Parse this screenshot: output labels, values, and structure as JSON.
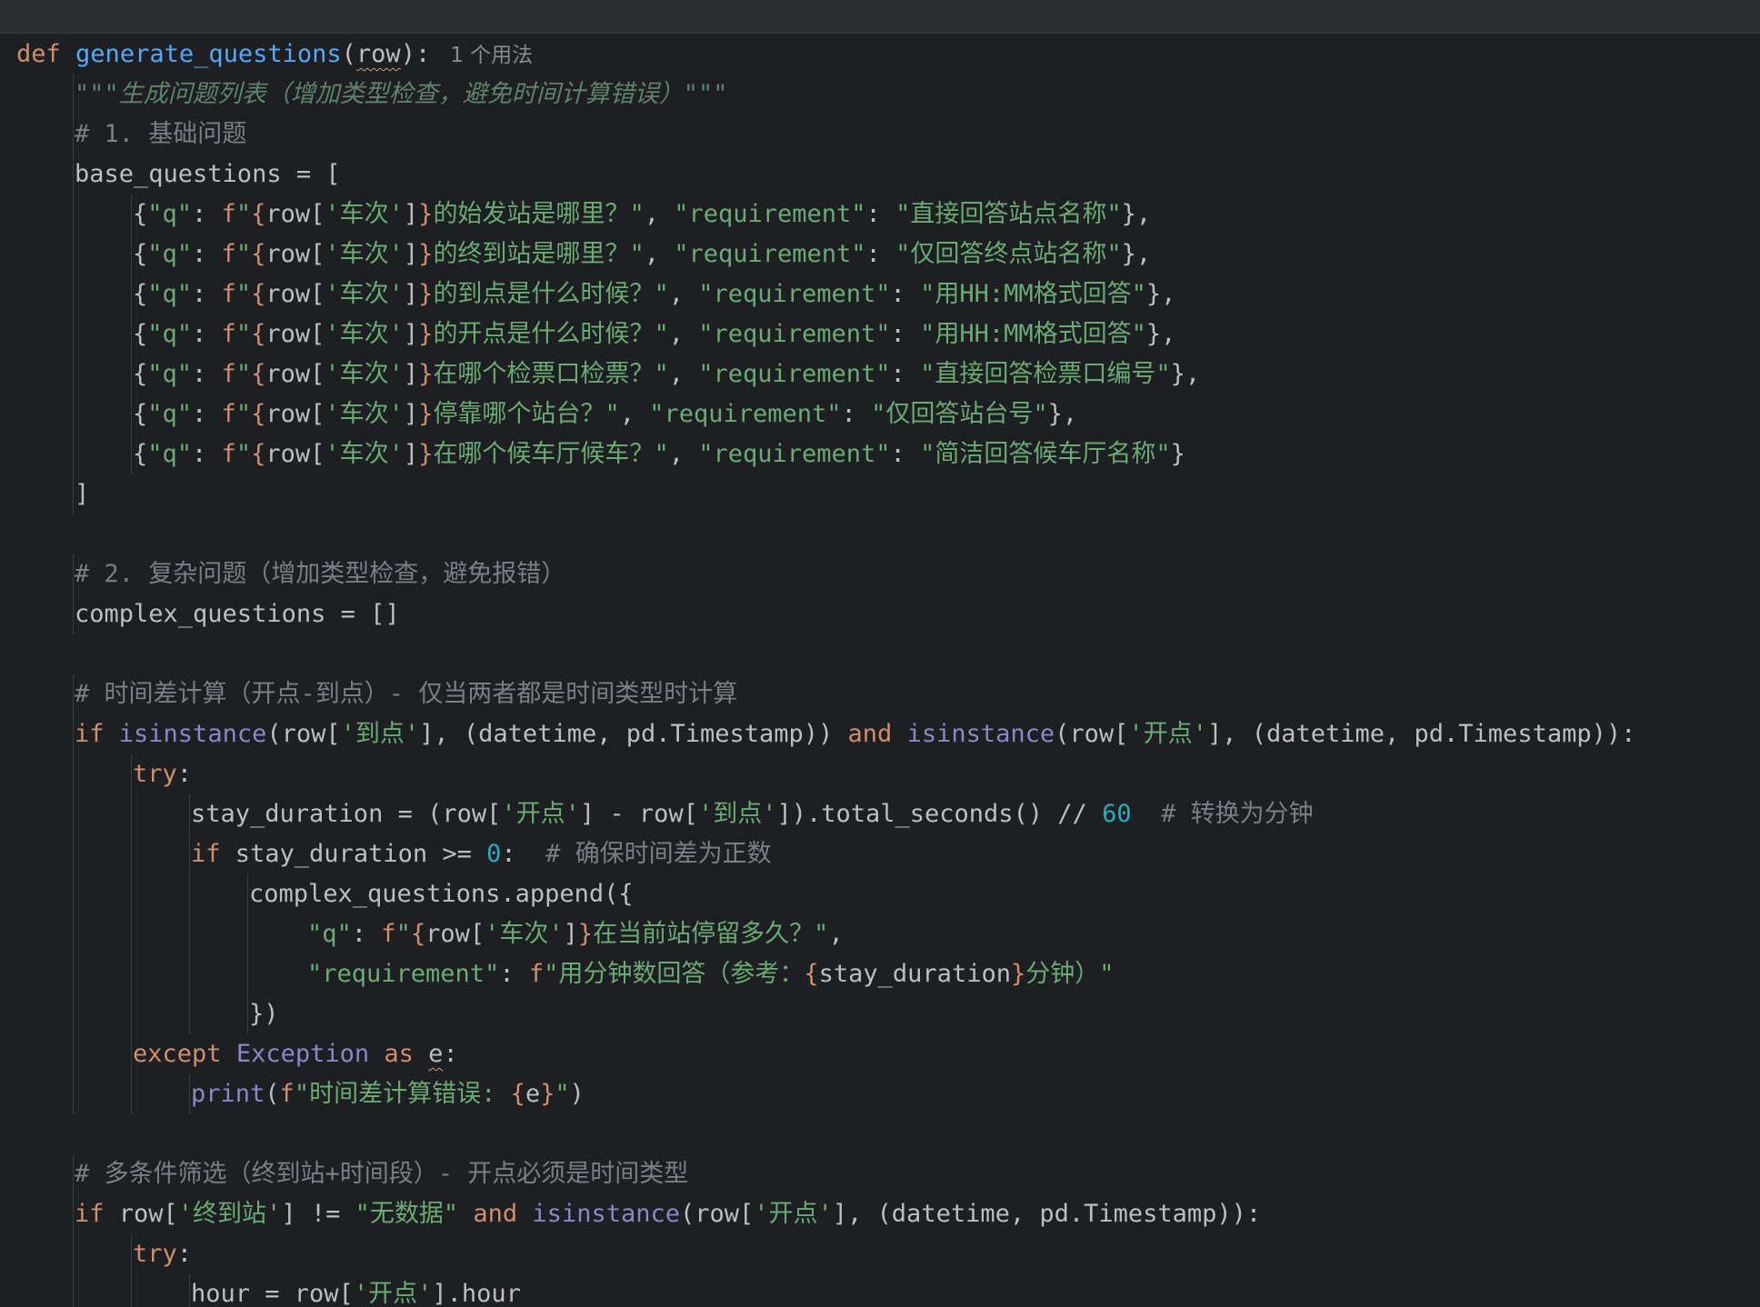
{
  "editor": {
    "usage_hint": "1 个用法",
    "lines": [
      {
        "id": "l1",
        "t": "def generate_questions(row):"
      },
      {
        "id": "l2",
        "t": "\"\"\"生成问题列表（增加类型检查，避免时间计算错误）\"\"\""
      },
      {
        "id": "l3",
        "t": "# 1. 基础问题"
      },
      {
        "id": "l4",
        "t": "base_questions = ["
      },
      {
        "id": "l5",
        "t": "{\"q\": f\"{row['车次']}的始发站是哪里？\", \"requirement\": \"直接回答站点名称\"},"
      },
      {
        "id": "l6",
        "t": "{\"q\": f\"{row['车次']}的终到站是哪里？\", \"requirement\": \"仅回答终点站名称\"},"
      },
      {
        "id": "l7",
        "t": "{\"q\": f\"{row['车次']}的到点是什么时候？\", \"requirement\": \"用HH:MM格式回答\"},"
      },
      {
        "id": "l8",
        "t": "{\"q\": f\"{row['车次']}的开点是什么时候？\", \"requirement\": \"用HH:MM格式回答\"},"
      },
      {
        "id": "l9",
        "t": "{\"q\": f\"{row['车次']}在哪个检票口检票？\", \"requirement\": \"直接回答检票口编号\"},"
      },
      {
        "id": "l10",
        "t": "{\"q\": f\"{row['车次']}停靠哪个站台？\", \"requirement\": \"仅回答站台号\"},"
      },
      {
        "id": "l11",
        "t": "{\"q\": f\"{row['车次']}在哪个候车厅候车？\", \"requirement\": \"简洁回答候车厅名称\"}"
      },
      {
        "id": "l12",
        "t": "]"
      },
      {
        "id": "l13",
        "t": ""
      },
      {
        "id": "l14",
        "t": "# 2. 复杂问题（增加类型检查，避免报错）"
      },
      {
        "id": "l15",
        "t": "complex_questions = []"
      },
      {
        "id": "l16",
        "t": ""
      },
      {
        "id": "l17",
        "t": "# 时间差计算（开点-到点）- 仅当两者都是时间类型时计算"
      },
      {
        "id": "l18",
        "t": "if isinstance(row['到点'], (datetime, pd.Timestamp)) and isinstance(row['开点'], (datetime, pd.Timestamp)):"
      },
      {
        "id": "l19",
        "t": "try:"
      },
      {
        "id": "l20",
        "t": "stay_duration = (row['开点'] - row['到点']).total_seconds() // 60  # 转换为分钟"
      },
      {
        "id": "l21",
        "t": "if stay_duration >= 0:  # 确保时间差为正数"
      },
      {
        "id": "l22",
        "t": "complex_questions.append({"
      },
      {
        "id": "l23",
        "t": "\"q\": f\"{row['车次']}在当前站停留多久？\","
      },
      {
        "id": "l24",
        "t": "\"requirement\": f\"用分钟数回答（参考：{stay_duration}分钟）\""
      },
      {
        "id": "l25",
        "t": "})"
      },
      {
        "id": "l26",
        "t": "except Exception as e:"
      },
      {
        "id": "l27",
        "t": "print(f\"时间差计算错误: {e}\")"
      },
      {
        "id": "l28",
        "t": ""
      },
      {
        "id": "l29",
        "t": "# 多条件筛选（终到站+时间段）- 开点必须是时间类型"
      },
      {
        "id": "l30",
        "t": "if row['终到站'] != \"无数据\" and isinstance(row['开点'], (datetime, pd.Timestamp)):"
      },
      {
        "id": "l31",
        "t": "try:"
      },
      {
        "id": "l32",
        "t": "hour = row['开点'].hour"
      }
    ]
  },
  "theme": {
    "background": "#1e1f22",
    "keyword": "#cf8e6d",
    "function": "#56a8f5",
    "string": "#6aab73",
    "comment": "#7a7e85",
    "number": "#2aacb8",
    "builtin": "#8888c6"
  }
}
